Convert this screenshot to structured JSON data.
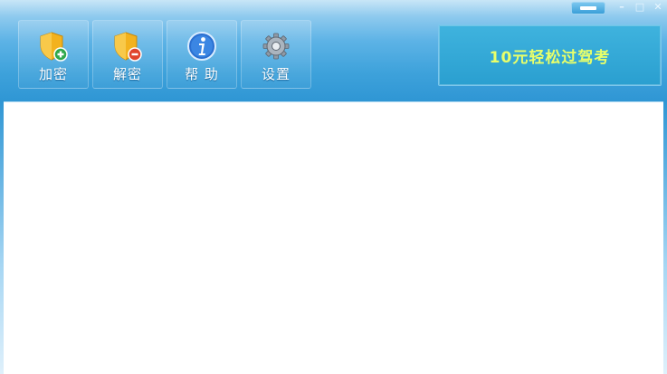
{
  "toolbar": {
    "buttons": [
      {
        "id": "encrypt",
        "label": "加密",
        "icon": "shield-plus-icon"
      },
      {
        "id": "decrypt",
        "label": "解密",
        "icon": "shield-minus-icon"
      },
      {
        "id": "help",
        "label": "帮 助",
        "icon": "info-icon"
      },
      {
        "id": "settings",
        "label": "设置",
        "icon": "gear-icon"
      }
    ]
  },
  "banner": {
    "text": "10元轻松过驾考"
  },
  "window_controls": {
    "minimize": "–",
    "maximize": "□",
    "close": "✕"
  },
  "colors": {
    "accent": "#3a9fd8",
    "banner_text": "#e8ff6a",
    "shield": "#f3b21e",
    "info_icon": "#2a6fd0"
  }
}
